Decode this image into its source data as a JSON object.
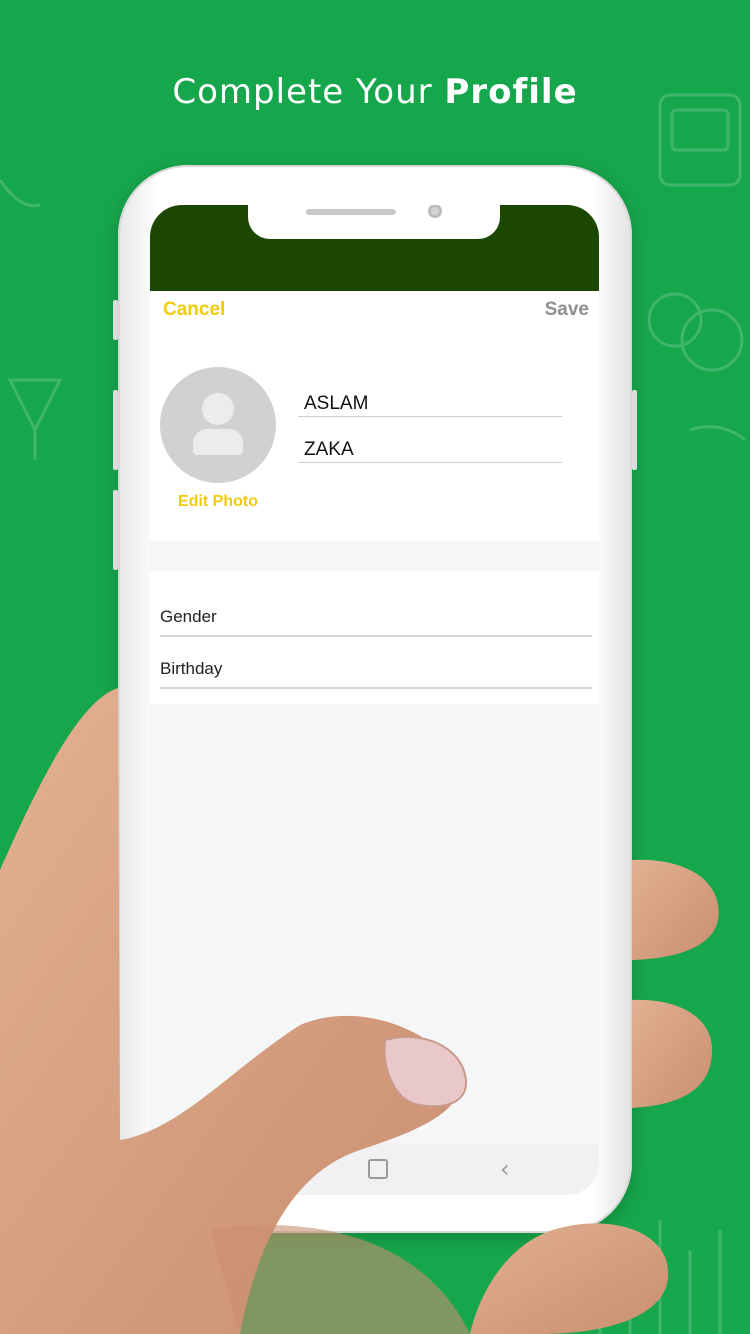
{
  "headline": {
    "normal": "Complete Your ",
    "bold": "Profile"
  },
  "nav": {
    "cancel": "Cancel",
    "save": "Save"
  },
  "profile": {
    "edit_photo": "Edit Photo",
    "first_name": "ASLAM",
    "last_name": "ZAKA"
  },
  "details": {
    "gender_label": "Gender",
    "birthday_label": "Birthday"
  },
  "icons": {
    "avatar": "person-placeholder-icon",
    "home": "home-icon",
    "back": "back-chevron-icon"
  },
  "colors": {
    "background": "#16a64b",
    "status_bar": "#1c4700",
    "accent": "#f2cc0c",
    "save_disabled": "#8f8f8f"
  }
}
